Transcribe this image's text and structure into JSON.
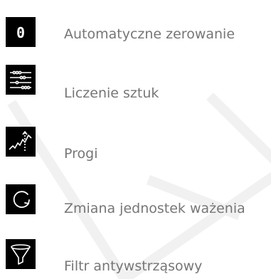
{
  "features": [
    {
      "icon": "zero-digit-icon",
      "label": "Automatyczne zerowanie"
    },
    {
      "icon": "piece-count-icon",
      "label": "Liczenie sztuk"
    },
    {
      "icon": "threshold-graph-icon",
      "label": "Progi"
    },
    {
      "icon": "unit-change-icon",
      "label": "Zmiana jednostek ważenia"
    },
    {
      "icon": "filter-funnel-icon",
      "label": "Filtr antywstrząsowy"
    }
  ],
  "colors": {
    "icon_background": "#000000",
    "icon_foreground": "#ffffff",
    "label_text": "#767676",
    "watermark": "#f1f1f1"
  }
}
